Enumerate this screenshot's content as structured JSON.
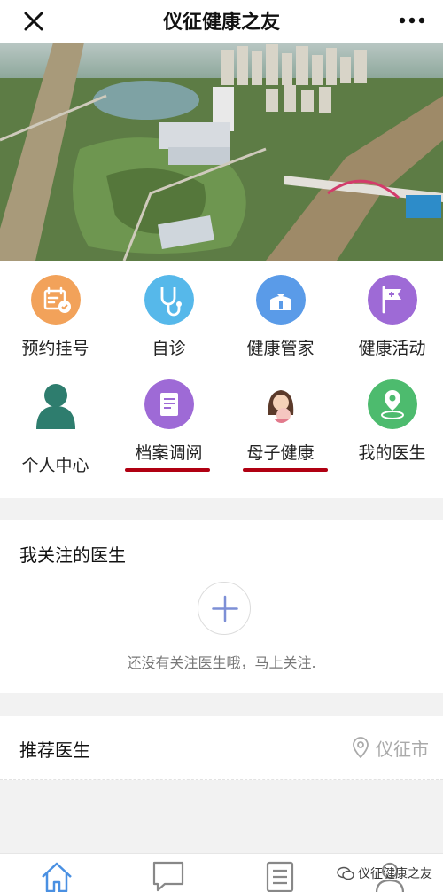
{
  "header": {
    "title": "仪征健康之友",
    "close_icon": "close-icon",
    "more_icon": "more-dots-icon"
  },
  "hero": {
    "icon": "aerial-city-photo"
  },
  "grid": [
    {
      "label": "预约挂号",
      "icon": "calendar-check-icon",
      "color": "#f2a25a"
    },
    {
      "label": "自诊",
      "icon": "stethoscope-icon",
      "color": "#56b8ea"
    },
    {
      "label": "健康管家",
      "icon": "butler-icon",
      "color": "#5a9be8"
    },
    {
      "label": "健康活动",
      "icon": "flag-icon",
      "color": "#9e6ad6"
    },
    {
      "label": "个人中心",
      "icon": "person-icon",
      "color": "#2e7d6e"
    },
    {
      "label": "档案调阅",
      "icon": "archive-book-icon",
      "color": "#9e6ad6"
    },
    {
      "label": "母子健康",
      "icon": "mother-child-icon",
      "color": "#e7a3a0"
    },
    {
      "label": "我的医生",
      "icon": "map-pin-doctor-icon",
      "color": "#4dbb6e"
    }
  ],
  "follow": {
    "title": "我关注的医生",
    "empty_text": "还没有关注医生哦，马上关注.",
    "add_icon": "plus-icon"
  },
  "recommend": {
    "title": "推荐医生",
    "city": "仪征市",
    "location_icon": "location-pin-icon"
  },
  "bottom_nav": {
    "items": [
      "home-icon",
      "chat-icon",
      "list-icon",
      "profile-icon"
    ],
    "watermark": "仪征健康之友",
    "watermark_icon": "wechat-icon"
  },
  "colors": {
    "accent": "#b00012",
    "active_nav": "#4a90e2"
  }
}
